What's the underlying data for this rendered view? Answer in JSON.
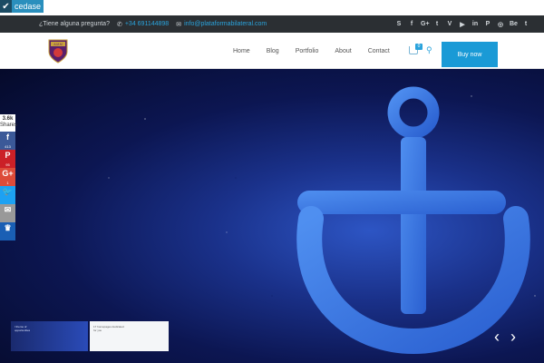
{
  "top_strip": {
    "label": "cedase"
  },
  "infobar": {
    "question": "¿Tiene alguna pregunta?",
    "phone": "+34 691144898",
    "email": "info@plataformabilateral.com",
    "social_icons": [
      "skype-icon",
      "facebook-icon",
      "google-plus-icon",
      "twitter-icon",
      "vimeo-icon",
      "youtube-icon",
      "linkedin-icon",
      "pinterest-icon",
      "instagram-icon",
      "behance-icon",
      "tumblr-icon"
    ],
    "social_glyphs": [
      "S",
      "f",
      "G+",
      "t",
      "V",
      "▶",
      "in",
      "P",
      "◎",
      "Be",
      "t"
    ]
  },
  "header": {
    "logo_text": "A.M.M",
    "nav": [
      "Home",
      "Blog",
      "Portfolio",
      "About",
      "Contact"
    ],
    "cart_count": "0",
    "buy_label": "Buy now"
  },
  "share": {
    "total": "3.6k",
    "total_label": "Shares",
    "buttons": [
      {
        "name": "facebook",
        "glyph": "f",
        "count": "413",
        "color": "#3b5998"
      },
      {
        "name": "pinterest",
        "glyph": "P",
        "count": "95",
        "color": "#cb2027"
      },
      {
        "name": "google-plus",
        "glyph": "G+",
        "count": "1",
        "color": "#dd4b39"
      },
      {
        "name": "twitter",
        "glyph": "🐦",
        "count": "",
        "color": "#1da1f2"
      },
      {
        "name": "email",
        "glyph": "✉",
        "count": "",
        "color": "#999999"
      },
      {
        "name": "more",
        "glyph": "♛",
        "count": "",
        "color": "#1a5fb4"
      }
    ]
  },
  "slider": {
    "thumb1_text": "/ theme of opportunities",
    "thumb2_text": "17 homepages dedicated for you",
    "prev": "‹",
    "next": "›"
  },
  "colors": {
    "accent": "#1a9ad6",
    "topbar": "#2b2f33"
  }
}
